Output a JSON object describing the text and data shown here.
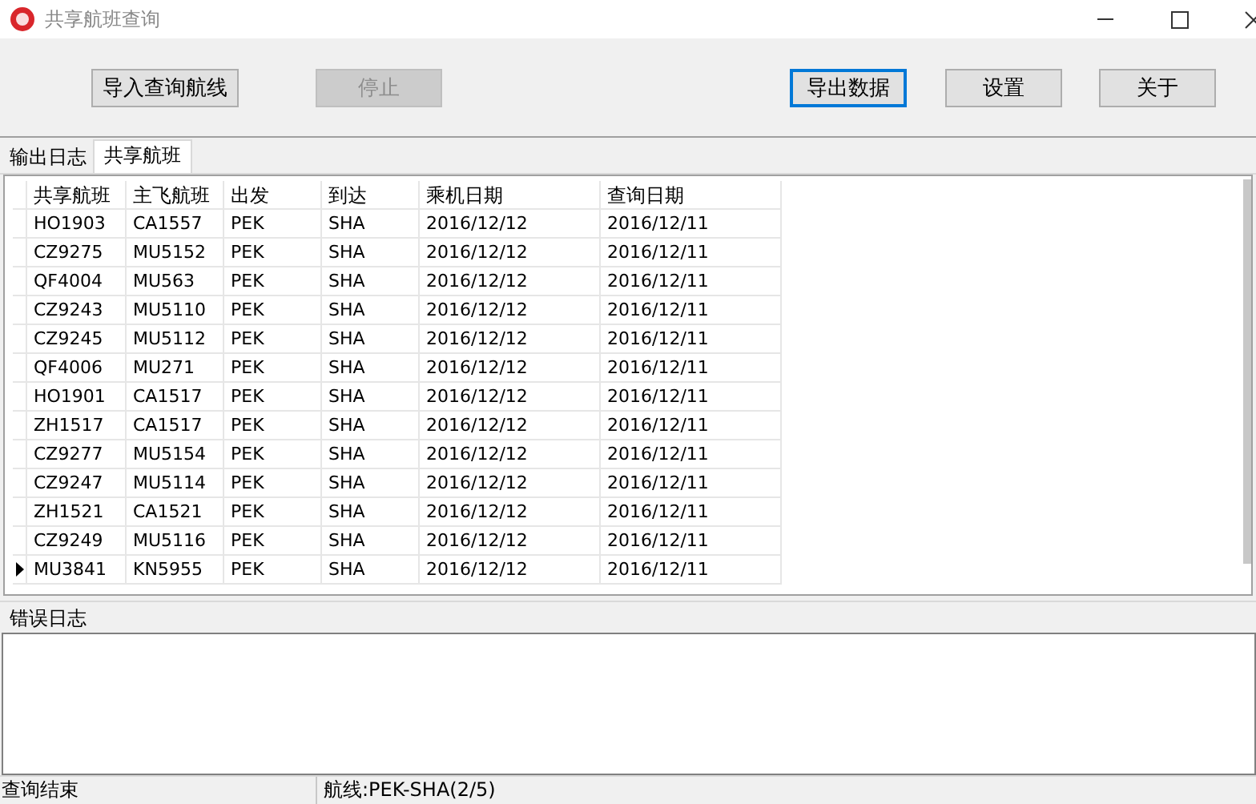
{
  "window": {
    "title": "共享航班查询"
  },
  "toolbar": {
    "buttons": [
      {
        "label": "导入查询航线",
        "disabled": false,
        "focused": false
      },
      {
        "label": "停止",
        "disabled": true,
        "focused": false
      },
      {
        "label": "导出数据",
        "disabled": false,
        "focused": true
      },
      {
        "label": "设置",
        "disabled": false,
        "focused": false
      },
      {
        "label": "关于",
        "disabled": false,
        "focused": false
      }
    ]
  },
  "tabs": [
    {
      "label": "输出日志",
      "selected": false
    },
    {
      "label": "共享航班",
      "selected": true
    }
  ],
  "table": {
    "columns": [
      "共享航班",
      "主飞航班",
      "出发",
      "到达",
      "乘机日期",
      "查询日期"
    ],
    "rows": [
      {
        "cells": [
          "HO1903",
          "CA1557",
          "PEK",
          "SHA",
          "2016/12/12",
          "2016/12/11"
        ],
        "current": false
      },
      {
        "cells": [
          "CZ9275",
          "MU5152",
          "PEK",
          "SHA",
          "2016/12/12",
          "2016/12/11"
        ],
        "current": false
      },
      {
        "cells": [
          "QF4004",
          "MU563",
          "PEK",
          "SHA",
          "2016/12/12",
          "2016/12/11"
        ],
        "current": false
      },
      {
        "cells": [
          "CZ9243",
          "MU5110",
          "PEK",
          "SHA",
          "2016/12/12",
          "2016/12/11"
        ],
        "current": false
      },
      {
        "cells": [
          "CZ9245",
          "MU5112",
          "PEK",
          "SHA",
          "2016/12/12",
          "2016/12/11"
        ],
        "current": false
      },
      {
        "cells": [
          "QF4006",
          "MU271",
          "PEK",
          "SHA",
          "2016/12/12",
          "2016/12/11"
        ],
        "current": false
      },
      {
        "cells": [
          "HO1901",
          "CA1517",
          "PEK",
          "SHA",
          "2016/12/12",
          "2016/12/11"
        ],
        "current": false
      },
      {
        "cells": [
          "ZH1517",
          "CA1517",
          "PEK",
          "SHA",
          "2016/12/12",
          "2016/12/11"
        ],
        "current": false
      },
      {
        "cells": [
          "CZ9277",
          "MU5154",
          "PEK",
          "SHA",
          "2016/12/12",
          "2016/12/11"
        ],
        "current": false
      },
      {
        "cells": [
          "CZ9247",
          "MU5114",
          "PEK",
          "SHA",
          "2016/12/12",
          "2016/12/11"
        ],
        "current": false
      },
      {
        "cells": [
          "ZH1521",
          "CA1521",
          "PEK",
          "SHA",
          "2016/12/12",
          "2016/12/11"
        ],
        "current": false
      },
      {
        "cells": [
          "CZ9249",
          "MU5116",
          "PEK",
          "SHA",
          "2016/12/12",
          "2016/12/11"
        ],
        "current": false
      },
      {
        "cells": [
          "MU3841",
          "KN5955",
          "PEK",
          "SHA",
          "2016/12/12",
          "2016/12/11"
        ],
        "current": true
      }
    ]
  },
  "error_log": {
    "title": "错误日志"
  },
  "status_bar": [
    "查询结束",
    "航线:PEK-SHA(2/5)"
  ]
}
